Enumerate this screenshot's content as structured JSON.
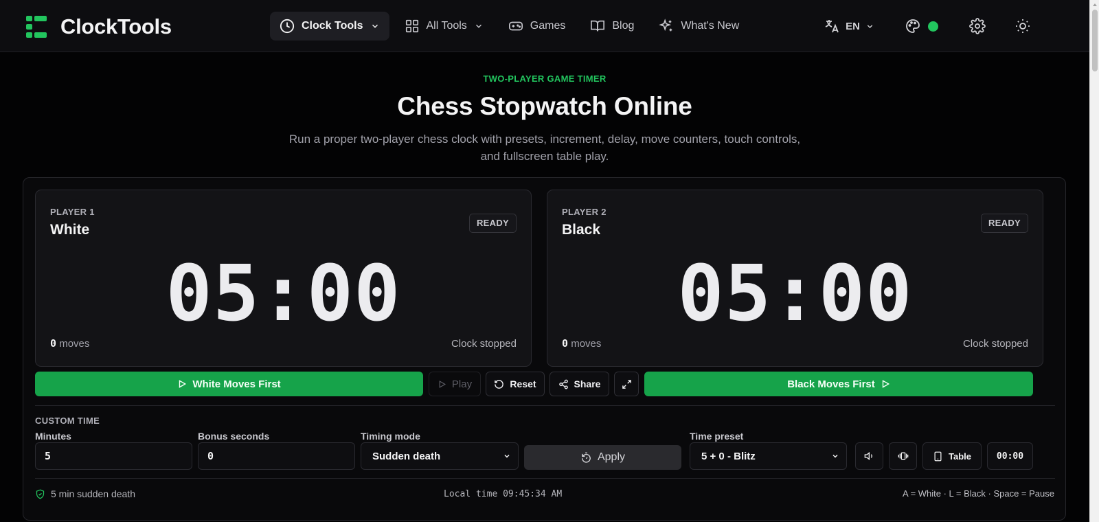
{
  "brand": {
    "name": "ClockTools",
    "accent": "#22c55e"
  },
  "nav": {
    "clock_tools": "Clock Tools",
    "all_tools": "All Tools",
    "games": "Games",
    "blog": "Blog",
    "whats_new": "What's New",
    "language": "EN"
  },
  "hero": {
    "eyebrow": "TWO-PLAYER GAME TIMER",
    "title": "Chess Stopwatch Online",
    "subtitle": "Run a proper two-player chess clock with presets, increment, delay, move counters, touch controls, and fullscreen table play."
  },
  "players": [
    {
      "label": "PLAYER 1",
      "name": "White",
      "badge": "READY",
      "time": "05:00",
      "moves": "0",
      "moves_suffix": " moves",
      "status": "Clock stopped"
    },
    {
      "label": "PLAYER 2",
      "name": "Black",
      "badge": "READY",
      "time": "05:00",
      "moves": "0",
      "moves_suffix": " moves",
      "status": "Clock stopped"
    }
  ],
  "controls": {
    "white_first": "White Moves First",
    "play": "Play",
    "reset": "Reset",
    "share": "Share",
    "black_first": "Black Moves First"
  },
  "custom": {
    "section": "CUSTOM TIME",
    "minutes_label": "Minutes",
    "minutes": "5",
    "bonus_label": "Bonus seconds",
    "bonus": "0",
    "mode_label": "Timing mode",
    "mode": "Sudden death",
    "apply": "Apply",
    "preset_label": "Time preset",
    "preset": "5 + 0 - Blitz",
    "table": "Table",
    "clock_display": "00:00"
  },
  "footer": {
    "summary": "5 min sudden death",
    "local_time": "Local time 09:45:34 AM",
    "shortcuts": "A = White · L = Black · Space = Pause"
  }
}
